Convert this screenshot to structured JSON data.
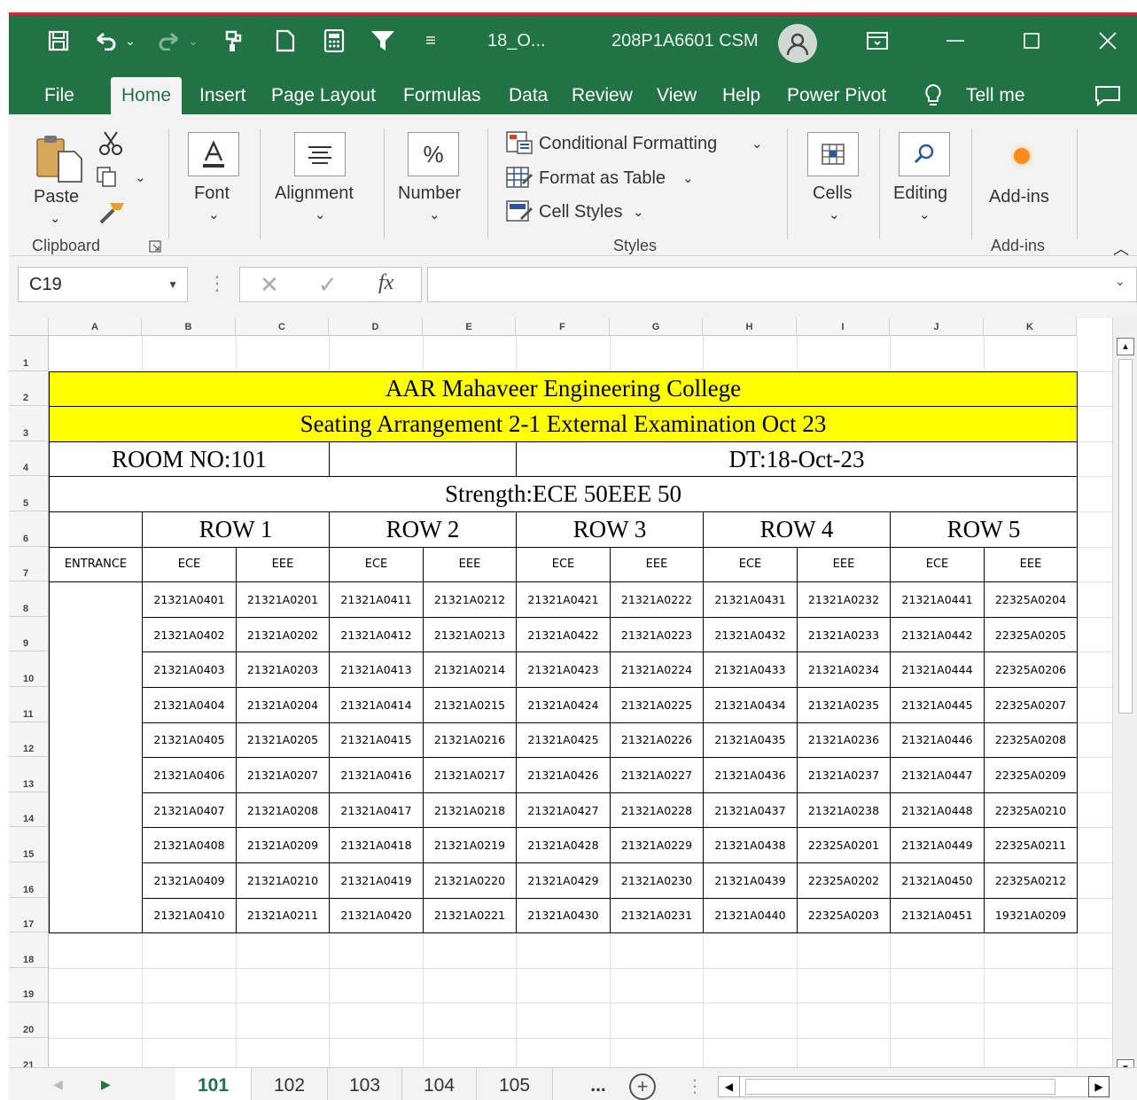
{
  "titlebar": {
    "doc_title": "18_O...",
    "user_name": "208P1A6601 CSM",
    "qat_dropdown": "≡"
  },
  "menu": {
    "tabs": [
      "File",
      "Home",
      "Insert",
      "Page Layout",
      "Formulas",
      "Data",
      "Review",
      "View",
      "Help",
      "Power Pivot"
    ],
    "tell_me": "Tell me"
  },
  "ribbon": {
    "paste": "Paste",
    "clipboard_group": "Clipboard",
    "font": "Font",
    "alignment": "Alignment",
    "number": "Number",
    "number_symbol": "%",
    "conditional_formatting": "Conditional Formatting",
    "format_as_table": "Format as Table",
    "cell_styles": "Cell Styles",
    "styles_group": "Styles",
    "cells": "Cells",
    "editing": "Editing",
    "add_ins": "Add-ins",
    "add_ins_group": "Add-ins"
  },
  "formula_bar": {
    "name_box": "C19",
    "formula_value": ""
  },
  "grid": {
    "columns": [
      "A",
      "B",
      "C",
      "D",
      "E",
      "F",
      "G",
      "H",
      "I",
      "J",
      "K"
    ],
    "rows": [
      "1",
      "2",
      "3",
      "4",
      "5",
      "6",
      "7",
      "8",
      "9",
      "10",
      "11",
      "12",
      "13",
      "14",
      "15",
      "16",
      "17",
      "18",
      "19",
      "20",
      "21"
    ]
  },
  "sheet": {
    "college": "AAR Mahaveer Engineering College",
    "exam": "Seating Arrangement 2-1 External Examination  Oct  23",
    "room": "ROOM NO:101",
    "date": "DT:18-Oct-23",
    "strength": "Strength:ECE 50EEE 50",
    "entrance": "ENTRANCE",
    "row_groups": [
      "ROW 1",
      "ROW 2",
      "ROW 3",
      "ROW 4",
      "ROW 5"
    ],
    "branches": [
      "ECE",
      "EEE",
      "ECE",
      "EEE",
      "ECE",
      "EEE",
      "ECE",
      "EEE",
      "ECE",
      "EEE"
    ],
    "rolls": [
      [
        "21321A0401",
        "21321A0201",
        "21321A0411",
        "21321A0212",
        "21321A0421",
        "21321A0222",
        "21321A0431",
        "21321A0232",
        "21321A0441",
        "22325A0204"
      ],
      [
        "21321A0402",
        "21321A0202",
        "21321A0412",
        "21321A0213",
        "21321A0422",
        "21321A0223",
        "21321A0432",
        "21321A0233",
        "21321A0442",
        "22325A0205"
      ],
      [
        "21321A0403",
        "21321A0203",
        "21321A0413",
        "21321A0214",
        "21321A0423",
        "21321A0224",
        "21321A0433",
        "21321A0234",
        "21321A0444",
        "22325A0206"
      ],
      [
        "21321A0404",
        "21321A0204",
        "21321A0414",
        "21321A0215",
        "21321A0424",
        "21321A0225",
        "21321A0434",
        "21321A0235",
        "21321A0445",
        "22325A0207"
      ],
      [
        "21321A0405",
        "21321A0205",
        "21321A0415",
        "21321A0216",
        "21321A0425",
        "21321A0226",
        "21321A0435",
        "21321A0236",
        "21321A0446",
        "22325A0208"
      ],
      [
        "21321A0406",
        "21321A0207",
        "21321A0416",
        "21321A0217",
        "21321A0426",
        "21321A0227",
        "21321A0436",
        "21321A0237",
        "21321A0447",
        "22325A0209"
      ],
      [
        "21321A0407",
        "21321A0208",
        "21321A0417",
        "21321A0218",
        "21321A0427",
        "21321A0228",
        "21321A0437",
        "21321A0238",
        "21321A0448",
        "22325A0210"
      ],
      [
        "21321A0408",
        "21321A0209",
        "21321A0418",
        "21321A0219",
        "21321A0428",
        "21321A0229",
        "21321A0438",
        "22325A0201",
        "21321A0449",
        "22325A0211"
      ],
      [
        "21321A0409",
        "21321A0210",
        "21321A0419",
        "21321A0220",
        "21321A0429",
        "21321A0230",
        "21321A0439",
        "22325A0202",
        "21321A0450",
        "22325A0212"
      ],
      [
        "21321A0410",
        "21321A0211",
        "21321A0420",
        "21321A0221",
        "21321A0430",
        "21321A0231",
        "21321A0440",
        "22325A0203",
        "21321A0451",
        "19321A0209"
      ]
    ]
  },
  "sheet_tabs": {
    "tabs": [
      "101",
      "102",
      "103",
      "104",
      "105"
    ],
    "active": "101",
    "more": "..."
  },
  "colors": {
    "excel_green": "#217346",
    "title_highlight": "#ffff00",
    "window_border": "#d6282a"
  }
}
